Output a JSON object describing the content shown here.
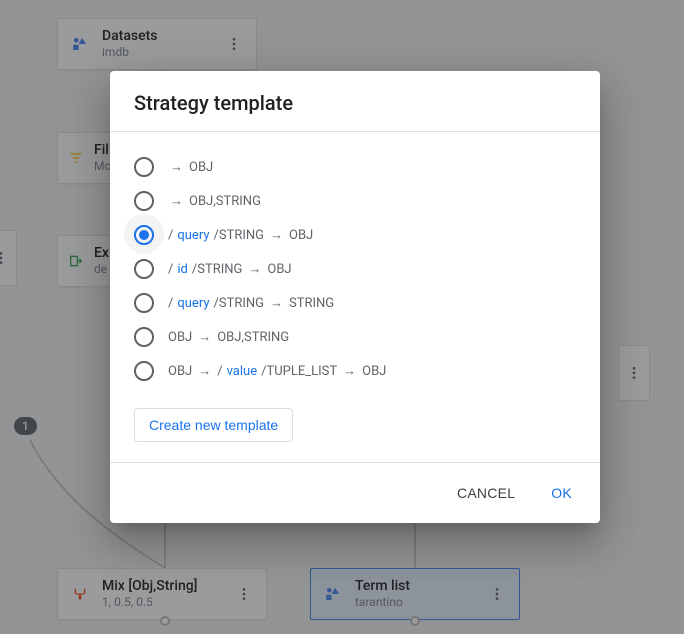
{
  "dialog": {
    "title": "Strategy template",
    "options": [
      {
        "segments": [
          {
            "t": "arrow"
          },
          {
            "t": "text",
            "v": "OBJ"
          }
        ]
      },
      {
        "segments": [
          {
            "t": "arrow"
          },
          {
            "t": "text",
            "v": "OBJ,STRING"
          }
        ]
      },
      {
        "segments": [
          {
            "t": "text",
            "v": "/"
          },
          {
            "t": "link",
            "v": "query"
          },
          {
            "t": "text",
            "v": "/STRING"
          },
          {
            "t": "arrow"
          },
          {
            "t": "text",
            "v": "OBJ"
          }
        ],
        "selected": true
      },
      {
        "segments": [
          {
            "t": "text",
            "v": "/"
          },
          {
            "t": "link",
            "v": "id"
          },
          {
            "t": "text",
            "v": "/STRING"
          },
          {
            "t": "arrow"
          },
          {
            "t": "text",
            "v": "OBJ"
          }
        ]
      },
      {
        "segments": [
          {
            "t": "text",
            "v": "/"
          },
          {
            "t": "link",
            "v": "query"
          },
          {
            "t": "text",
            "v": "/STRING"
          },
          {
            "t": "arrow"
          },
          {
            "t": "text",
            "v": "STRING"
          }
        ]
      },
      {
        "segments": [
          {
            "t": "text",
            "v": "OBJ"
          },
          {
            "t": "arrow"
          },
          {
            "t": "text",
            "v": "OBJ,STRING"
          }
        ]
      },
      {
        "segments": [
          {
            "t": "text",
            "v": "OBJ"
          },
          {
            "t": "arrow"
          },
          {
            "t": "text",
            "v": "/"
          },
          {
            "t": "link",
            "v": "value"
          },
          {
            "t": "text",
            "v": "/TUPLE_LIST"
          },
          {
            "t": "arrow"
          },
          {
            "t": "text",
            "v": "OBJ"
          }
        ]
      }
    ],
    "arrow_glyph": "→",
    "create_label": "Create new template",
    "cancel_label": "CANCEL",
    "ok_label": "OK"
  },
  "nodes": {
    "datasets": {
      "title": "Datasets",
      "sub": "imdb"
    },
    "filter": {
      "title": "Fil",
      "sub": "Mo"
    },
    "export": {
      "title": "Ex",
      "sub": "de"
    },
    "mix": {
      "title": "Mix [Obj,String]",
      "sub": "1, 0.5, 0.5"
    },
    "term": {
      "title": "Term list",
      "sub": "tarantino"
    }
  },
  "badge": "1",
  "icons": {
    "datasets": "datasets-icon",
    "filter": "filter-icon",
    "export": "export-icon",
    "mix": "mix-icon",
    "term": "term-icon"
  }
}
